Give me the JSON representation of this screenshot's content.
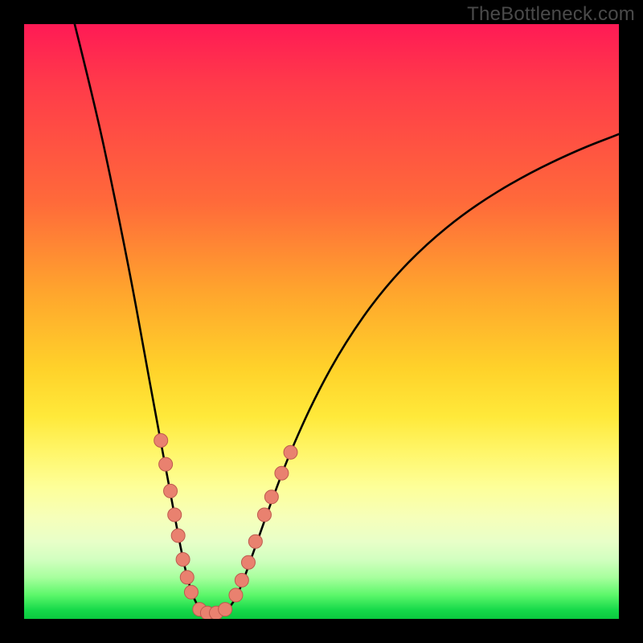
{
  "watermark": "TheBottleneck.com",
  "colors": {
    "frame": "#000000",
    "curve": "#000000",
    "bead_fill": "#e9816f",
    "bead_stroke": "#be5a4e"
  },
  "chart_data": {
    "type": "line",
    "title": "",
    "xlabel": "",
    "ylabel": "",
    "xlim": [
      0,
      100
    ],
    "ylim": [
      0,
      100
    ],
    "grid": false,
    "legend": false,
    "note": "Decorative bottleneck V-curve on a vertical rainbow heat gradient. No axes, ticks, or numeric labels are drawn. Curve samples below are (x,y) in percent of plot area, y=0 at bottom.",
    "series": [
      {
        "name": "v_curve",
        "points": [
          [
            8.5,
            100.0
          ],
          [
            12.0,
            86.0
          ],
          [
            15.0,
            72.0
          ],
          [
            18.0,
            57.0
          ],
          [
            20.0,
            46.0
          ],
          [
            22.0,
            35.0
          ],
          [
            23.5,
            27.0
          ],
          [
            25.0,
            19.0
          ],
          [
            26.3,
            12.0
          ],
          [
            27.5,
            6.5
          ],
          [
            28.7,
            3.0
          ],
          [
            29.8,
            1.3
          ],
          [
            31.0,
            0.7
          ],
          [
            32.5,
            0.7
          ],
          [
            34.0,
            1.3
          ],
          [
            35.5,
            3.2
          ],
          [
            37.0,
            6.8
          ],
          [
            39.0,
            12.5
          ],
          [
            41.5,
            19.5
          ],
          [
            44.5,
            27.5
          ],
          [
            49.0,
            37.5
          ],
          [
            54.0,
            46.5
          ],
          [
            60.0,
            55.0
          ],
          [
            67.0,
            62.5
          ],
          [
            75.0,
            69.0
          ],
          [
            84.0,
            74.5
          ],
          [
            93.0,
            78.8
          ],
          [
            100.0,
            81.5
          ]
        ]
      }
    ],
    "markers": {
      "name": "beads",
      "radius_pct": 1.15,
      "points": [
        [
          23.0,
          30.0
        ],
        [
          23.8,
          26.0
        ],
        [
          24.6,
          21.5
        ],
        [
          25.3,
          17.5
        ],
        [
          25.9,
          14.0
        ],
        [
          26.7,
          10.0
        ],
        [
          27.4,
          7.0
        ],
        [
          28.1,
          4.5
        ],
        [
          29.5,
          1.6
        ],
        [
          30.8,
          1.0
        ],
        [
          32.3,
          1.0
        ],
        [
          33.8,
          1.6
        ],
        [
          35.6,
          4.0
        ],
        [
          36.6,
          6.5
        ],
        [
          37.7,
          9.5
        ],
        [
          38.9,
          13.0
        ],
        [
          40.4,
          17.5
        ],
        [
          41.6,
          20.5
        ],
        [
          43.3,
          24.5
        ],
        [
          44.8,
          28.0
        ]
      ]
    }
  }
}
